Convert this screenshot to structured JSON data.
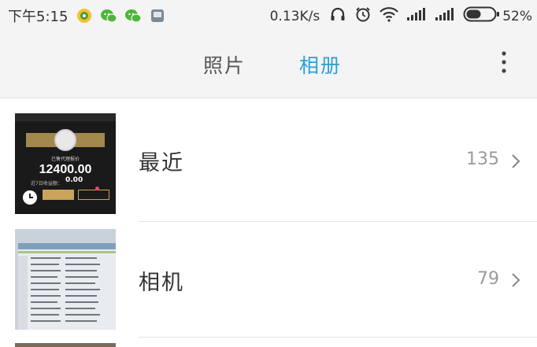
{
  "status_bar": {
    "time": "下午5:15",
    "net_speed": "0.13K/s",
    "battery_percent": "52%",
    "battery_level": 0.52,
    "icons": [
      "app-notification-icon",
      "wechat-icon",
      "wechat-icon",
      "message-icon",
      "headset-icon",
      "alarm-icon",
      "wifi-icon",
      "signal-icon",
      "signal-icon",
      "battery-icon"
    ]
  },
  "header": {
    "tabs": [
      {
        "label": "照片",
        "active": false
      },
      {
        "label": "相册",
        "active": true
      }
    ],
    "menu_icon": "more-vertical-icon",
    "accent_color": "#2aa0db"
  },
  "albums": [
    {
      "name": "最近",
      "count": "135",
      "thumb": {
        "caption": "已售代理报价",
        "amount": "12400.00",
        "sub_label": "近7日收益额：",
        "sub_value": "0.00",
        "badge_icon": "clock-icon"
      }
    },
    {
      "name": "相机",
      "count": "79"
    }
  ]
}
